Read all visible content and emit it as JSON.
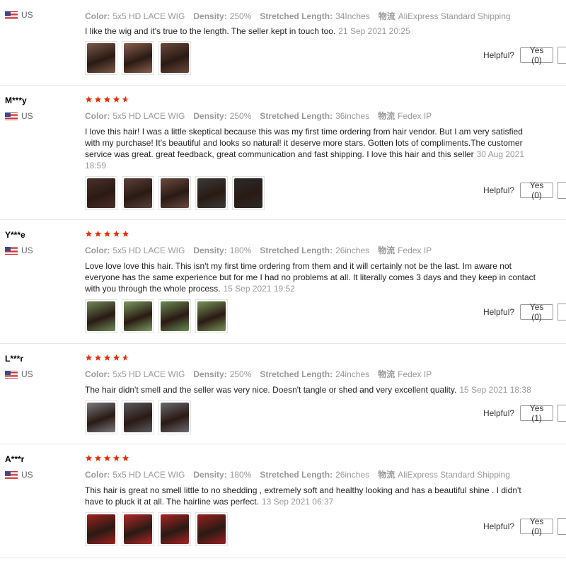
{
  "labels": {
    "color": "Color:",
    "density": "Density:",
    "length": "Stretched Length:",
    "shipping": "物流",
    "helpful": "Helpful?"
  },
  "colors": {
    "star": "#e62e04",
    "accent": "#e62e04"
  },
  "reviews": [
    {
      "user": "",
      "country": "US",
      "stars": 0,
      "color": "5x5 HD LACE WIG",
      "density": "250%",
      "length": "34Inches",
      "shipping": "AliExpress Standard Shipping",
      "text": "I like the wig and it's true to the length. The seller kept in touch too.",
      "date": "21 Sep 2021 20:25",
      "photos": 3,
      "yes": "Yes (0)"
    },
    {
      "user": "M***y",
      "country": "US",
      "stars": 4.5,
      "color": "5x5 HD LACE WIG",
      "density": "250%",
      "length": "36inches",
      "shipping": "Fedex IP",
      "text": "I love this hair! I was a little skeptical because this was my first time ordering from hair vendor. But I am very satisfied with my purchase! It's beautiful and looks so natural! it deserve more stars. Gotten lots of compliments.The customer service was great. great feedback, great communication and fast shipping. I love this hair and this seller",
      "date": "30 Aug 2021 18:59",
      "photos": 5,
      "yes": "Yes (0)"
    },
    {
      "user": "Y***e",
      "country": "US",
      "stars": 5,
      "color": "5x5 HD LACE WIG",
      "density": "180%",
      "length": "26inches",
      "shipping": "Fedex IP",
      "text": "Love love love this hair. This isn't my first time ordering from them and it will certainly not be the last. Im aware not everyone has the same experience but for me I had no problems at all. It literally comes 3 days and they keep in contact with you through the whole process.",
      "date": "15 Sep 2021 19:52",
      "photos": 4,
      "yes": "Yes (0)"
    },
    {
      "user": "L***r",
      "country": "US",
      "stars": 4.5,
      "color": "5x5 HD LACE WIG",
      "density": "250%",
      "length": "24inches",
      "shipping": "Fedex IP",
      "text": "The hair didn't smell and the seller was very nice. Doesn't tangle or shed and very excellent quality.",
      "date": "15 Sep 2021 18:38",
      "photos": 3,
      "yes": "Yes (1)"
    },
    {
      "user": "A***r",
      "country": "US",
      "stars": 5,
      "color": "5x5 HD LACE WIG",
      "density": "180%",
      "length": "26inches",
      "shipping": "AliExpress Standard Shipping",
      "text": "This hair is great no smell little to no shedding , extremely soft and healthy looking and has a beautiful shine . I didn't have to pluck it at all. The hairline was perfect.",
      "date": "13 Sep 2021 06:37",
      "photos": 4,
      "yes": "Yes (0)"
    }
  ]
}
